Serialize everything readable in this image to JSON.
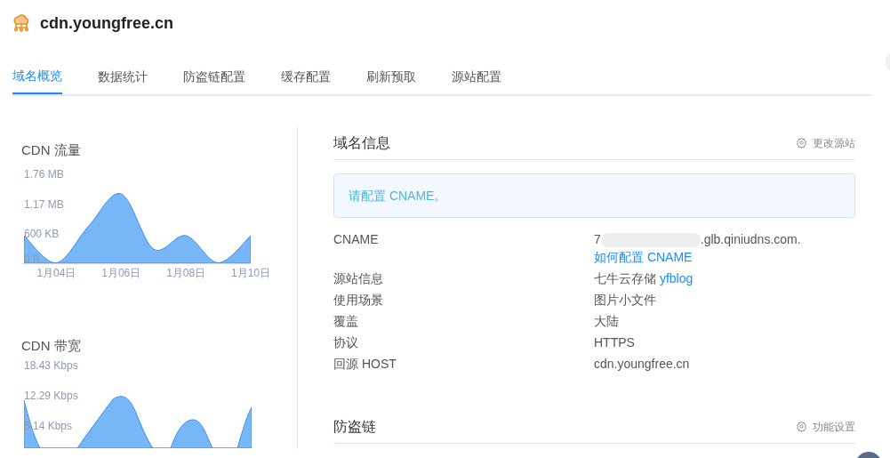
{
  "header": {
    "title": "cdn.youngfree.cn"
  },
  "tabs": [
    {
      "label": "域名概览",
      "selected": true
    },
    {
      "label": "数据统计",
      "selected": false
    },
    {
      "label": "防盗链配置",
      "selected": false
    },
    {
      "label": "缓存配置",
      "selected": false
    },
    {
      "label": "刷新预取",
      "selected": false
    },
    {
      "label": "源站配置",
      "selected": false
    }
  ],
  "charts": [
    {
      "title": "CDN 流量",
      "axis_labels": [
        "1.76 MB",
        "1.17 MB",
        "600 KB",
        "0 B"
      ],
      "date_labels": [
        "1月04日",
        "1月06日",
        "1月08日",
        "1月10日"
      ]
    },
    {
      "title": "CDN 带宽",
      "axis_labels": [
        "18.43 Kbps",
        "12.29 Kbps",
        "6.14 Kbps"
      ]
    }
  ],
  "domain_info": {
    "title": "域名信息",
    "action": "更改源站",
    "notice": "请配置 CNAME。",
    "rows": [
      {
        "label": "CNAME",
        "value": ".glb.qiniudns.com.",
        "prefix": "7",
        "redacted": true,
        "link": "如何配置 CNAME"
      },
      {
        "label": "源站信息",
        "value": "七牛云存储",
        "link": "yfblog"
      },
      {
        "label": "使用场景",
        "value": "图片小文件"
      },
      {
        "label": "覆盖",
        "value": "大陆"
      },
      {
        "label": "协议",
        "value": "HTTPS"
      },
      {
        "label": "回源 HOST",
        "value": "cdn.youngfree.cn"
      }
    ]
  },
  "hotlink": {
    "title": "防盗链",
    "action": "功能设置"
  }
}
